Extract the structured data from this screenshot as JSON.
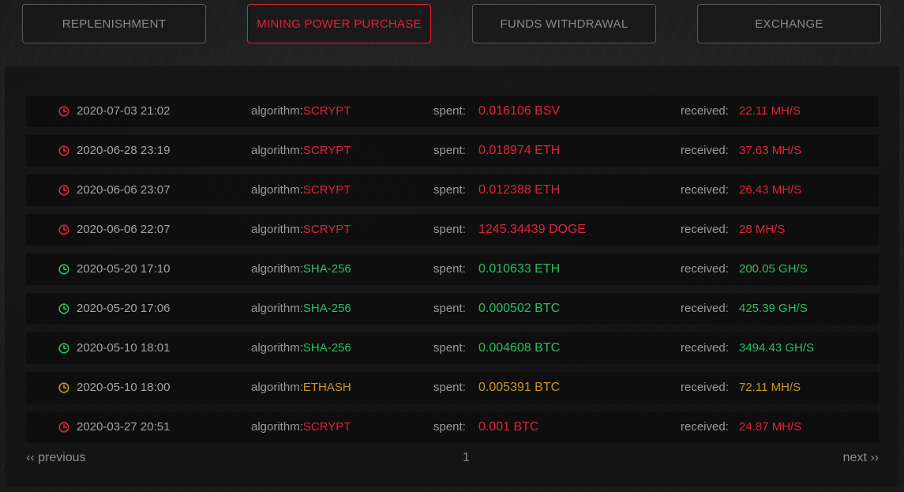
{
  "tabs": [
    {
      "label": "REPLENISHMENT",
      "active": false
    },
    {
      "label": "MINING POWER PURCHASE",
      "active": true
    },
    {
      "label": "FUNDS WITHDRAWAL",
      "active": false
    },
    {
      "label": "EXCHANGE",
      "active": false
    }
  ],
  "labels": {
    "algorithm": "algorithm:",
    "spent": "spent:",
    "received": "received:"
  },
  "colors": {
    "red": "#e0233a",
    "green": "#29c05a",
    "amber": "#c9952b"
  },
  "rows": [
    {
      "datetime": "2020-07-03 21:02",
      "algorithm": "SCRYPT",
      "spent": "0.016106 BSV",
      "received": "22.11 MH/S",
      "status": "red"
    },
    {
      "datetime": "2020-06-28 23:19",
      "algorithm": "SCRYPT",
      "spent": "0.018974 ETH",
      "received": "37.63 MH/S",
      "status": "red"
    },
    {
      "datetime": "2020-06-06 23:07",
      "algorithm": "SCRYPT",
      "spent": "0.012388 ETH",
      "received": "26.43 MH/S",
      "status": "red"
    },
    {
      "datetime": "2020-06-06 22:07",
      "algorithm": "SCRYPT",
      "spent": "1245.34439 DOGE",
      "received": "28 MH/S",
      "status": "red"
    },
    {
      "datetime": "2020-05-20 17:10",
      "algorithm": "SHA-256",
      "spent": "0.010633 ETH",
      "received": "200.05 GH/S",
      "status": "green"
    },
    {
      "datetime": "2020-05-20 17:06",
      "algorithm": "SHA-256",
      "spent": "0.000502 BTC",
      "received": "425.39 GH/S",
      "status": "green"
    },
    {
      "datetime": "2020-05-10 18:01",
      "algorithm": "SHA-256",
      "spent": "0.004608 BTC",
      "received": "3494.43 GH/S",
      "status": "green"
    },
    {
      "datetime": "2020-05-10 18:00",
      "algorithm": "ETHASH",
      "spent": "0.005391 BTC",
      "received": "72.11 MH/S",
      "status": "amber"
    },
    {
      "datetime": "2020-03-27 20:51",
      "algorithm": "SCRYPT",
      "spent": "0.001 BTC",
      "received": "24.87 MH/S",
      "status": "red"
    }
  ],
  "row_icon": "clock-icon",
  "pagination": {
    "previous": "‹‹ previous",
    "current_page": "1",
    "next": "next ››"
  }
}
